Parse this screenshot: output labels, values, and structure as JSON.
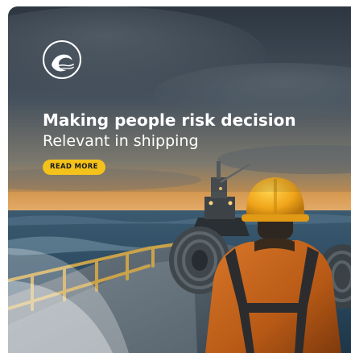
{
  "banner": {
    "headline": "Making people risk decision",
    "subline": "Relevant in shipping",
    "cta_label": "READ MORE",
    "logo_icon": "wave-logo-icon",
    "colors": {
      "cta_background": "#f4c21a",
      "text": "#ffffff",
      "sky": "#3e4a57",
      "sea": "#2c4a5f",
      "jacket": "#c9651b",
      "helmet": "#f0a51a"
    }
  }
}
